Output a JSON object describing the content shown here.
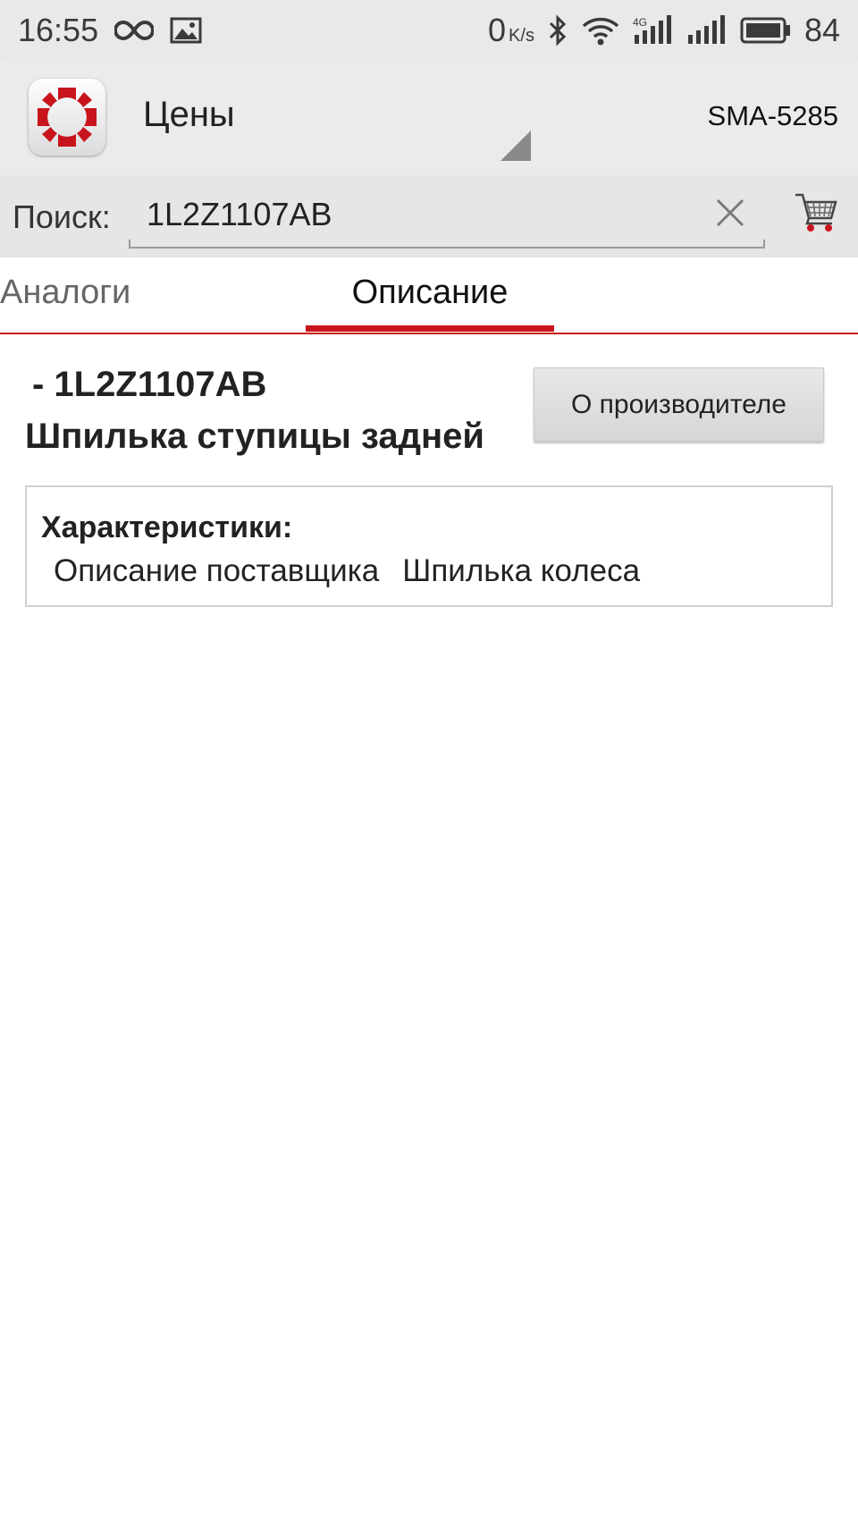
{
  "status_bar": {
    "time": "16:55",
    "net_speed": "0",
    "net_speed_unit": "K/s",
    "battery": "84",
    "network_type": "4G",
    "icons": [
      "infinity-icon",
      "image-icon",
      "bluetooth-icon",
      "wifi-icon",
      "signal-4g-icon",
      "signal-icon",
      "battery-icon"
    ]
  },
  "action_bar": {
    "title": "Цены",
    "account_code": "SMA-5285",
    "brand_color": "#c8141d"
  },
  "search": {
    "label": "Поиск:",
    "value": "1L2Z1107AB"
  },
  "tabs": [
    {
      "label": "Аналоги",
      "active": false
    },
    {
      "label": "Описание",
      "active": true
    }
  ],
  "part": {
    "code_line": " - 1L2Z1107AB",
    "name": "Шпилька ступицы задней",
    "manufacturer_button": "О производителе"
  },
  "specs": {
    "title": "Характеристики:",
    "rows": [
      {
        "name": "Описание поставщика",
        "value": "Шпилька колеса"
      }
    ]
  }
}
